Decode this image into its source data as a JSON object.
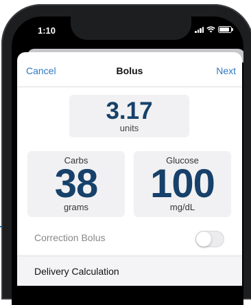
{
  "status_bar": {
    "time": "1:10"
  },
  "nav": {
    "cancel": "Cancel",
    "title": "Bolus",
    "next": "Next"
  },
  "total": {
    "value": "3.17",
    "unit": "units"
  },
  "carbs": {
    "label": "Carbs",
    "value": "38",
    "unit": "grams"
  },
  "glucose": {
    "label": "Glucose",
    "value": "100",
    "unit": "mg/dL"
  },
  "correction": {
    "label": "Correction Bolus",
    "enabled": false
  },
  "delivery": {
    "label": "Delivery Calculation"
  },
  "colors": {
    "accent": "#2f79c2",
    "value_text": "#17416a",
    "card_bg": "#f1f1f3"
  }
}
